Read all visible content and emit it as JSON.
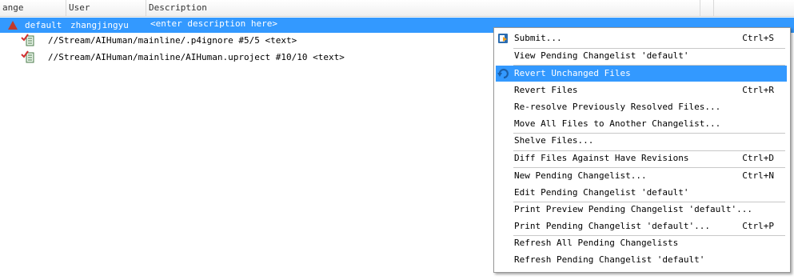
{
  "columns": {
    "change": "ange",
    "user": "User",
    "description": "Description"
  },
  "changelist": {
    "name": "default",
    "user": "zhangjingyu",
    "description": "<enter description here>"
  },
  "files": [
    {
      "path": "//Stream/AIHuman/mainline/.p4ignore #5/5 <text>",
      "icon": "edit-file-icon"
    },
    {
      "path": "//Stream/AIHuman/mainline/AIHuman.uproject #10/10 <text>",
      "icon": "edit-file-icon"
    }
  ],
  "context_menu": {
    "items": [
      {
        "label": "Submit...",
        "shortcut": "Ctrl+S"
      },
      {
        "label": "View Pending Changelist 'default'",
        "shortcut": ""
      },
      {
        "label": "Revert Unchanged Files",
        "shortcut": ""
      },
      {
        "label": "Revert Files",
        "shortcut": "Ctrl+R"
      },
      {
        "label": "Re-resolve Previously Resolved Files...",
        "shortcut": ""
      },
      {
        "label": "Move All Files to Another Changelist...",
        "shortcut": ""
      },
      {
        "label": "Shelve Files...",
        "shortcut": ""
      },
      {
        "label": "Diff Files Against Have Revisions",
        "shortcut": "Ctrl+D"
      },
      {
        "label": "New Pending Changelist...",
        "shortcut": "Ctrl+N"
      },
      {
        "label": "Edit Pending Changelist 'default'",
        "shortcut": ""
      },
      {
        "label": "Print Preview Pending Changelist 'default'...",
        "shortcut": ""
      },
      {
        "label": "Print Pending Changelist 'default'...",
        "shortcut": "Ctrl+P"
      },
      {
        "label": "Refresh All Pending Changelists",
        "shortcut": ""
      },
      {
        "label": "Refresh Pending Changelist 'default'",
        "shortcut": ""
      }
    ],
    "highlighted": "Revert Unchanged Files"
  },
  "colors": {
    "selection": "#3399ff",
    "warning": "#c0392b",
    "checkmark": "#d32f2f"
  }
}
